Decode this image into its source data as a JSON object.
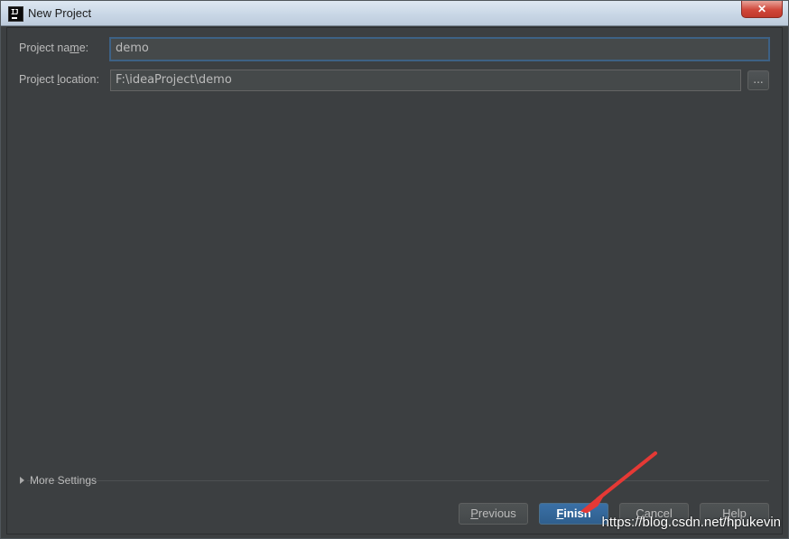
{
  "window": {
    "title": "New Project",
    "close_symbol": "✕"
  },
  "form": {
    "project_name": {
      "label_before": "Project na",
      "label_mnemonic": "m",
      "label_after": "e:",
      "value": "demo"
    },
    "project_location": {
      "label_before": "Project ",
      "label_mnemonic": "l",
      "label_after": "ocation:",
      "value": "F:\\ideaProject\\demo",
      "browse_label": "..."
    }
  },
  "more_settings": {
    "label": "More Settings",
    "expanded": false
  },
  "buttons": {
    "previous": {
      "mnemonic": "P",
      "rest": "revious"
    },
    "finish": {
      "mnemonic": "F",
      "rest": "inish"
    },
    "cancel": {
      "mnemonic": "C",
      "rest": "ancel"
    },
    "help": {
      "mnemonic": "H",
      "rest": "elp"
    }
  },
  "annotation": {
    "arrow_color": "#e53935"
  },
  "watermark": "https://blog.csdn.net/hpukevin",
  "colors": {
    "dialog_background": "#3c3f41",
    "primary_button": "#365880",
    "focus_border": "#3d6185"
  }
}
